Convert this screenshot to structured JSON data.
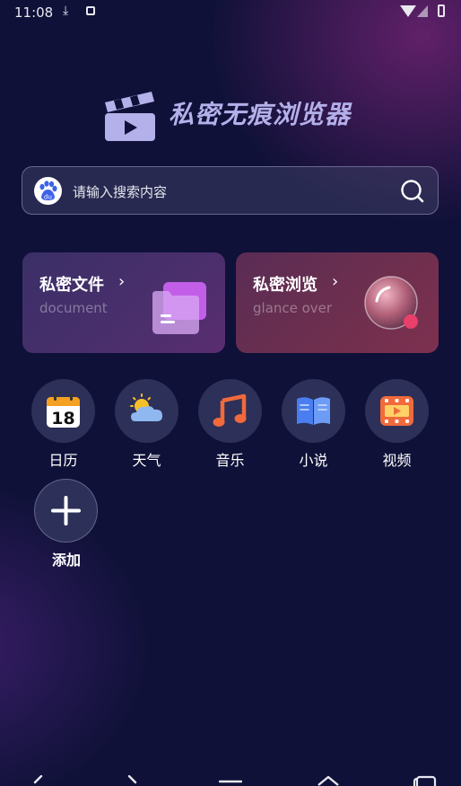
{
  "status_bar": {
    "time": "11:08",
    "download_icon": "download-icon",
    "icons": [
      "wifi-icon",
      "signal-icon",
      "battery-icon"
    ]
  },
  "app": {
    "title": "私密无痕浏览器",
    "logo_icon": "clapperboard-icon",
    "title_color": "#b4b0ea"
  },
  "search": {
    "placeholder": "请输入搜索内容",
    "engine_icon": "baidu-icon",
    "search_icon": "search-icon"
  },
  "cards": [
    {
      "title": "私密文件",
      "subtitle": "document",
      "icon": "folder-icon"
    },
    {
      "title": "私密浏览",
      "subtitle": "glance over",
      "icon": "glass-ball-icon"
    }
  ],
  "apps": [
    {
      "label": "日历",
      "icon": "calendar-icon",
      "badge": "18"
    },
    {
      "label": "天气",
      "icon": "weather-icon"
    },
    {
      "label": "音乐",
      "icon": "music-icon"
    },
    {
      "label": "小说",
      "icon": "book-icon"
    },
    {
      "label": "视频",
      "icon": "video-icon"
    }
  ],
  "add": {
    "label": "添加",
    "icon": "plus-icon"
  },
  "nav_bar": [
    "back-icon",
    "forward-icon",
    "menu-icon",
    "home-icon",
    "tabs-icon"
  ],
  "colors": {
    "background": "#0f1138",
    "accent_pink": "#e8406a",
    "accent_orange": "#f06a3c",
    "accent_blue": "#4a7ef0"
  }
}
